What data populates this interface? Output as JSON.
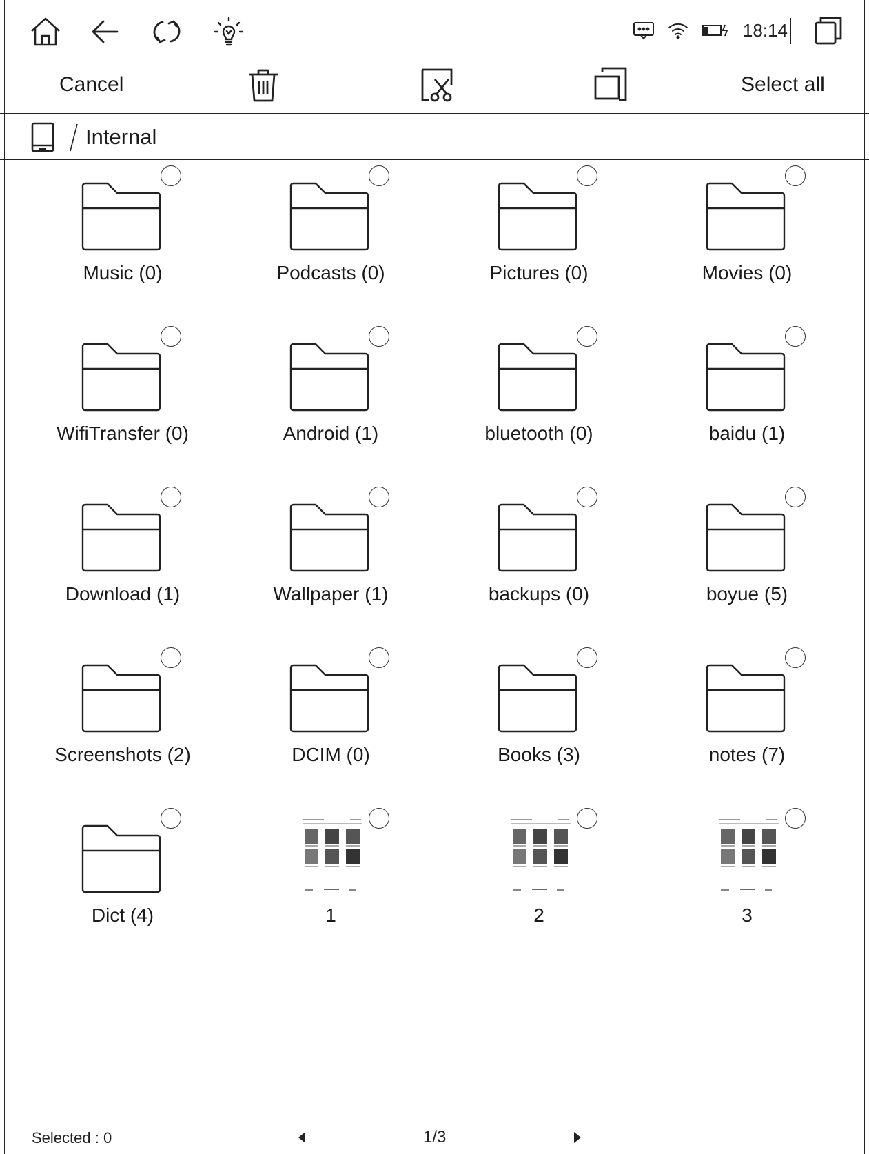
{
  "status_bar": {
    "time": "18:14",
    "icons": [
      "home-icon",
      "back-arrow-icon",
      "refresh-icon",
      "light-bulb-icon",
      "message-icon",
      "wifi-icon",
      "battery-icon",
      "recent-apps-icon"
    ]
  },
  "action_bar": {
    "cancel_label": "Cancel",
    "select_all_label": "Select all",
    "icons": [
      "trash-icon",
      "cut-icon",
      "copy-icon"
    ]
  },
  "breadcrumb": {
    "separator": "/",
    "location": "Internal",
    "icon": "tablet-icon"
  },
  "items": [
    {
      "label": "Music (0)",
      "type": "folder"
    },
    {
      "label": "Podcasts (0)",
      "type": "folder"
    },
    {
      "label": "Pictures (0)",
      "type": "folder"
    },
    {
      "label": "Movies (0)",
      "type": "folder"
    },
    {
      "label": "WifiTransfer (0)",
      "type": "folder"
    },
    {
      "label": "Android (1)",
      "type": "folder"
    },
    {
      "label": "bluetooth (0)",
      "type": "folder"
    },
    {
      "label": "baidu (1)",
      "type": "folder"
    },
    {
      "label": "Download (1)",
      "type": "folder"
    },
    {
      "label": "Wallpaper (1)",
      "type": "folder"
    },
    {
      "label": "backups (0)",
      "type": "folder"
    },
    {
      "label": "boyue (5)",
      "type": "folder"
    },
    {
      "label": "Screenshots (2)",
      "type": "folder"
    },
    {
      "label": "DCIM (0)",
      "type": "folder"
    },
    {
      "label": "Books (3)",
      "type": "folder"
    },
    {
      "label": "notes (7)",
      "type": "folder"
    },
    {
      "label": "Dict (4)",
      "type": "folder"
    },
    {
      "label": "1",
      "type": "image"
    },
    {
      "label": "2",
      "type": "image"
    },
    {
      "label": "3",
      "type": "image"
    }
  ],
  "footer": {
    "selected_text": "Selected : 0",
    "page_indicator": "1/3",
    "icons": [
      "prev-page-icon",
      "next-page-icon"
    ]
  }
}
